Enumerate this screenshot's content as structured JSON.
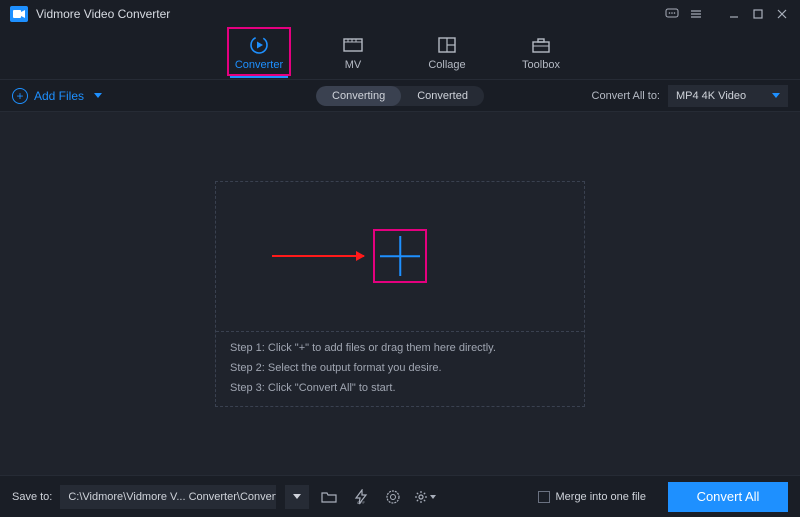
{
  "titlebar": {
    "app_title": "Vidmore Video Converter"
  },
  "nav": {
    "items": [
      {
        "label": "Converter",
        "icon": "converter-icon",
        "active": true
      },
      {
        "label": "MV",
        "icon": "mv-icon",
        "active": false
      },
      {
        "label": "Collage",
        "icon": "collage-icon",
        "active": false
      },
      {
        "label": "Toolbox",
        "icon": "toolbox-icon",
        "active": false
      }
    ]
  },
  "subbar": {
    "add_files_label": "Add Files",
    "segment": {
      "converting": "Converting",
      "converted": "Converted"
    },
    "convert_all_to_label": "Convert All to:",
    "format_value": "MP4 4K Video"
  },
  "dropzone": {
    "steps": [
      "Step 1: Click \"+\" to add files or drag them here directly.",
      "Step 2: Select the output format you desire.",
      "Step 3: Click \"Convert All\" to start."
    ]
  },
  "bottombar": {
    "save_to_label": "Save to:",
    "path_value": "C:\\Vidmore\\Vidmore V... Converter\\Converted",
    "merge_label": "Merge into one file",
    "convert_all_label": "Convert All"
  }
}
